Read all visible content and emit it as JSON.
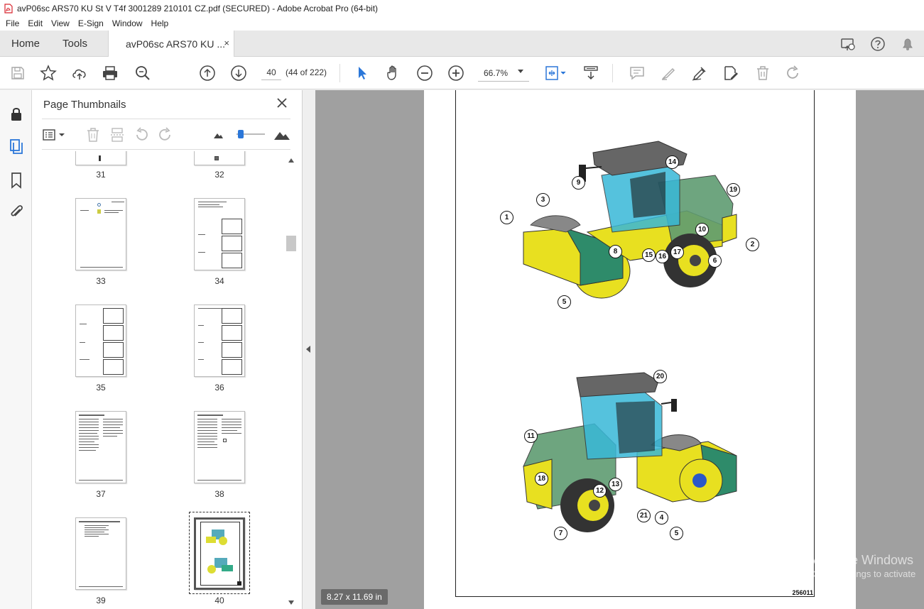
{
  "window": {
    "title": "avP06sc ARS70 KU St V T4f 3001289 210101 CZ.pdf (SECURED) - Adobe Acrobat Pro (64-bit)"
  },
  "menu": [
    "File",
    "Edit",
    "View",
    "E-Sign",
    "Window",
    "Help"
  ],
  "tabs": {
    "home": "Home",
    "tools": "Tools",
    "document": "avP06sc ARS70 KU ...",
    "close": "×"
  },
  "toolbar": {
    "page_number": "40",
    "page_count": "(44 of 222)",
    "zoom": "66.7%"
  },
  "thumbnails": {
    "title": "Page Thumbnails",
    "close": "✕",
    "pages": [
      "31",
      "32",
      "33",
      "34",
      "35",
      "36",
      "37",
      "38",
      "39",
      "40"
    ],
    "selected": "40"
  },
  "document": {
    "page_size": "8.27 x 11.69 in",
    "figure_number": "256011",
    "callouts_top": [
      "14",
      "9",
      "19",
      "3",
      "1",
      "10",
      "2",
      "8",
      "15",
      "16",
      "17",
      "6",
      "5"
    ],
    "callouts_bottom": [
      "20",
      "11",
      "18",
      "13",
      "12",
      "21",
      "4",
      "5",
      "7"
    ]
  },
  "watermark": {
    "line1": "Activate Windows",
    "line2": "Go to Settings to activate"
  },
  "colors": {
    "accent_blue": "#2b77d9",
    "pdf_red": "#d8262f",
    "machine_yellow": "#e8e020",
    "machine_green": "#2e8b6a",
    "cab_blue": "#38b8d8",
    "roof_gray": "#666666"
  }
}
